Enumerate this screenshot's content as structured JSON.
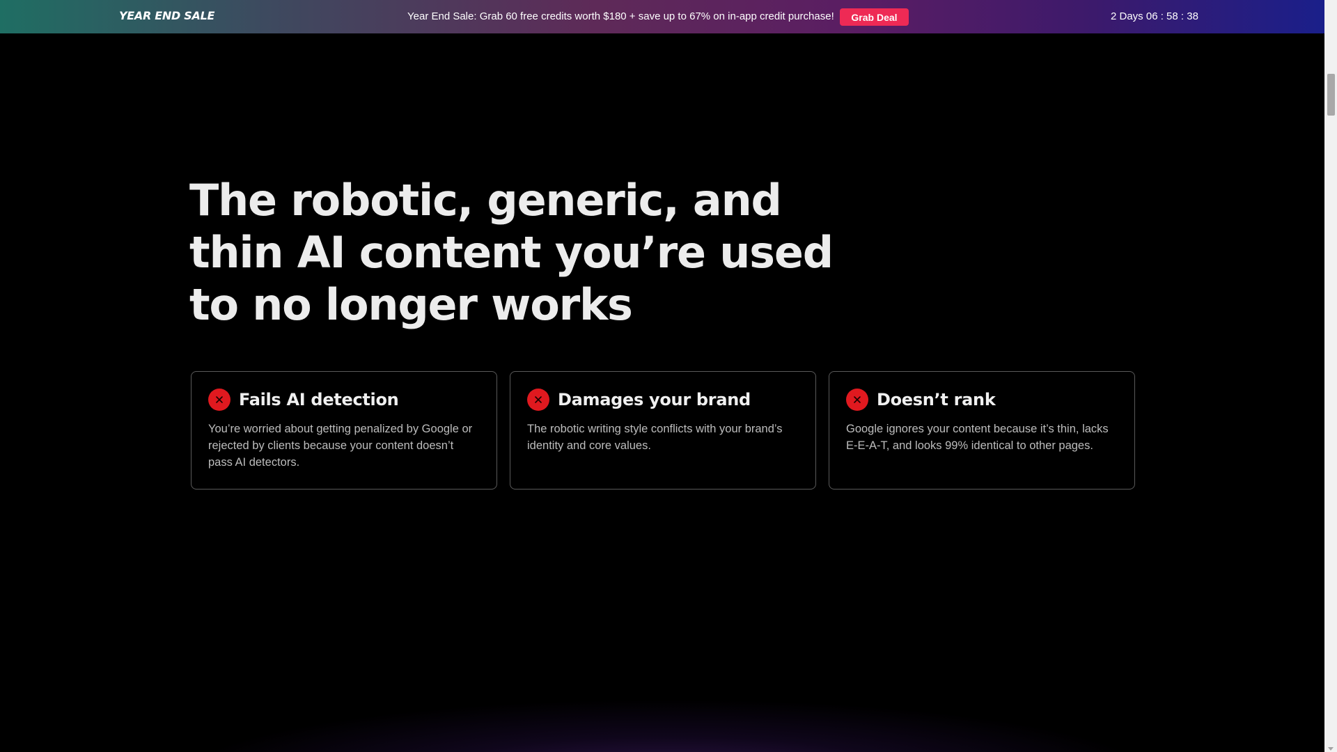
{
  "promo": {
    "title": "YEAR END SALE",
    "message": "Year End Sale: Grab 60 free credits worth $180 + save up to 67% on in-app credit purchase!",
    "button_label": "Grab Deal",
    "countdown": "2 Days 06 : 58 : 38"
  },
  "main": {
    "headline": "The robotic, generic, and thin AI content you’re used to no longer works",
    "cards": [
      {
        "icon": "x-icon",
        "title": "Fails AI detection",
        "body": "You’re worried about getting penalized by Google or rejected by clients because your content doesn’t pass AI detectors."
      },
      {
        "icon": "x-icon",
        "title": "Damages your brand",
        "body": "The robotic writing style conflicts with your brand’s identity and core values."
      },
      {
        "icon": "x-icon",
        "title": "Doesn’t rank",
        "body": "Google ignores your content because it’s thin, lacks E-E-A-T, and looks 99% identical to other pages."
      }
    ]
  },
  "colors": {
    "accent_red": "#e0191f",
    "deal_button": "#ee2a55",
    "background": "#000000"
  }
}
